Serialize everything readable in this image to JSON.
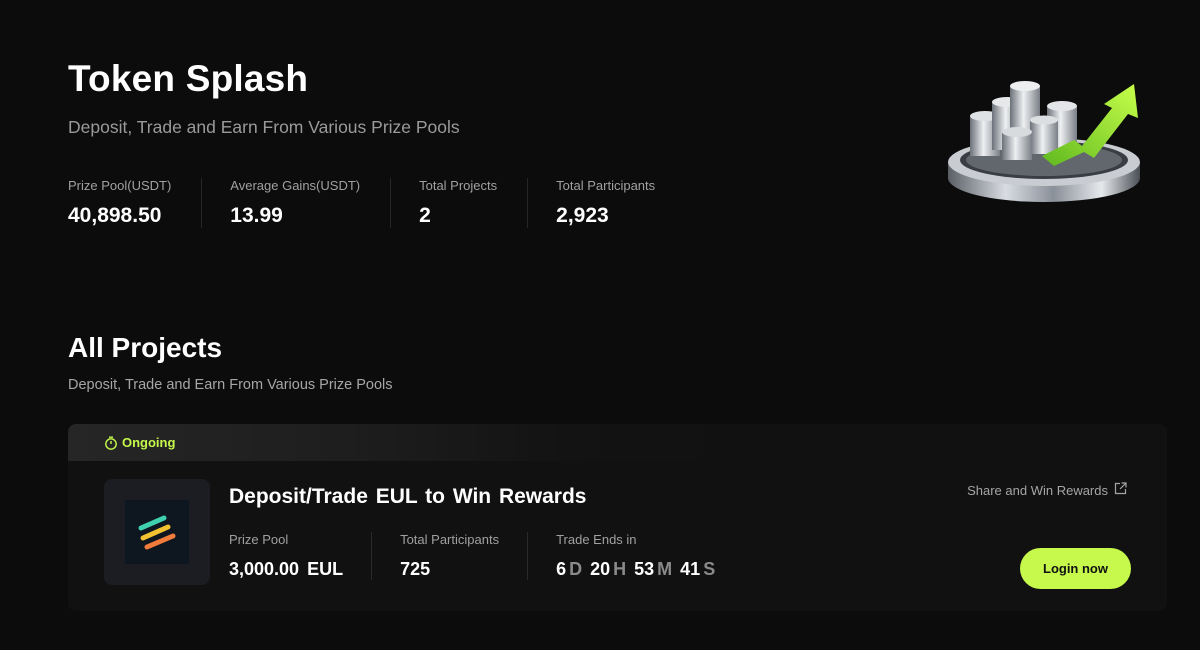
{
  "hero": {
    "title": "Token Splash",
    "subtitle": "Deposit, Trade and Earn From Various Prize Pools",
    "stats": [
      {
        "label": "Prize Pool(USDT)",
        "value": "40,898.50"
      },
      {
        "label": "Average Gains(USDT)",
        "value": "13.99"
      },
      {
        "label": "Total Projects",
        "value": "2"
      },
      {
        "label": "Total Participants",
        "value": "2,923"
      }
    ],
    "illustration_icon": "coins-platform-arrow-icon"
  },
  "projects": {
    "title": "All Projects",
    "subtitle": "Deposit, Trade and Earn From Various Prize Pools",
    "items": [
      {
        "status": "Ongoing",
        "status_icon": "stopwatch-icon",
        "logo_icon": "eul-logo-icon",
        "title": "Deposit/Trade  EUL  to Win Rewards",
        "share_label": "Share and Win Rewards",
        "share_icon": "external-link-icon",
        "prize_pool_label": "Prize Pool",
        "prize_pool_value": "3,000.00  EUL",
        "participants_label": "Total Participants",
        "participants_value": "725",
        "trade_ends_label": "Trade Ends in",
        "countdown": {
          "days": "6",
          "days_unit": "D",
          "hours": "20",
          "hours_unit": "H",
          "minutes": "53",
          "minutes_unit": "M",
          "seconds": "41",
          "seconds_unit": "S"
        },
        "cta_label": "Login now"
      }
    ]
  },
  "colors": {
    "background": "#0c0c0c",
    "card": "#111111",
    "accent": "#c6f94b",
    "muted_text": "#9a9a9a"
  }
}
